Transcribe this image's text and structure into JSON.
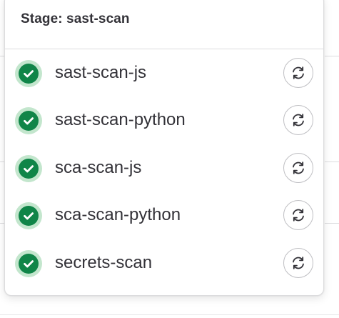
{
  "stage_dropdown": {
    "title": "Stage: sast-scan",
    "jobs": [
      {
        "name": "sast-scan-js",
        "status": "passed",
        "status_icon": "check-circle-icon",
        "action_icon": "retry-icon"
      },
      {
        "name": "sast-scan-python",
        "status": "passed",
        "status_icon": "check-circle-icon",
        "action_icon": "retry-icon"
      },
      {
        "name": "sca-scan-js",
        "status": "passed",
        "status_icon": "check-circle-icon",
        "action_icon": "retry-icon"
      },
      {
        "name": "sca-scan-python",
        "status": "passed",
        "status_icon": "check-circle-icon",
        "action_icon": "retry-icon"
      },
      {
        "name": "secrets-scan",
        "status": "passed",
        "status_icon": "check-circle-icon",
        "action_icon": "retry-icon"
      }
    ]
  },
  "colors": {
    "success": "#108548",
    "success_halo": "#c3e6cd",
    "text": "#333238",
    "border": "#dcdcde"
  }
}
